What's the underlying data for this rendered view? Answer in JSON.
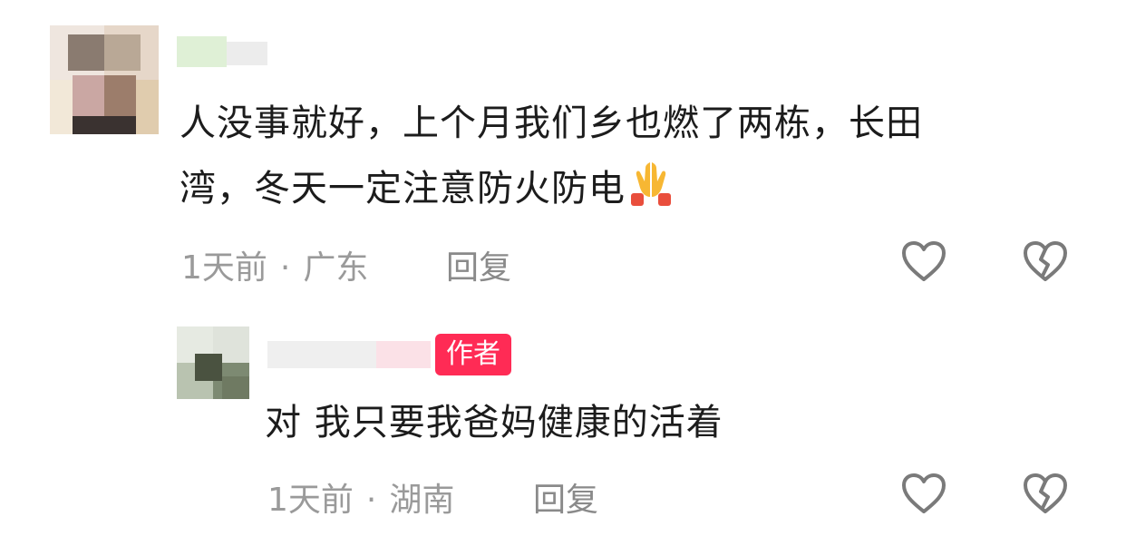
{
  "comments": [
    {
      "text_line1": "人没事就好，上个月我们乡也燃了两栋，长田",
      "text_line2": "湾，冬天一定注意防火防电",
      "emoji": "folded-hands",
      "time": "1天前",
      "separator": "·",
      "location": "广东",
      "reply_label": "回复"
    },
    {
      "badge": "作者",
      "text": "对 我只要我爸妈健康的活着",
      "time": "1天前",
      "separator": "·",
      "location": "湖南",
      "reply_label": "回复"
    }
  ],
  "colors": {
    "badge": "#ff2b55",
    "meta": "#9a9a9a"
  },
  "icons": [
    "heart-outline-icon",
    "broken-heart-icon"
  ]
}
